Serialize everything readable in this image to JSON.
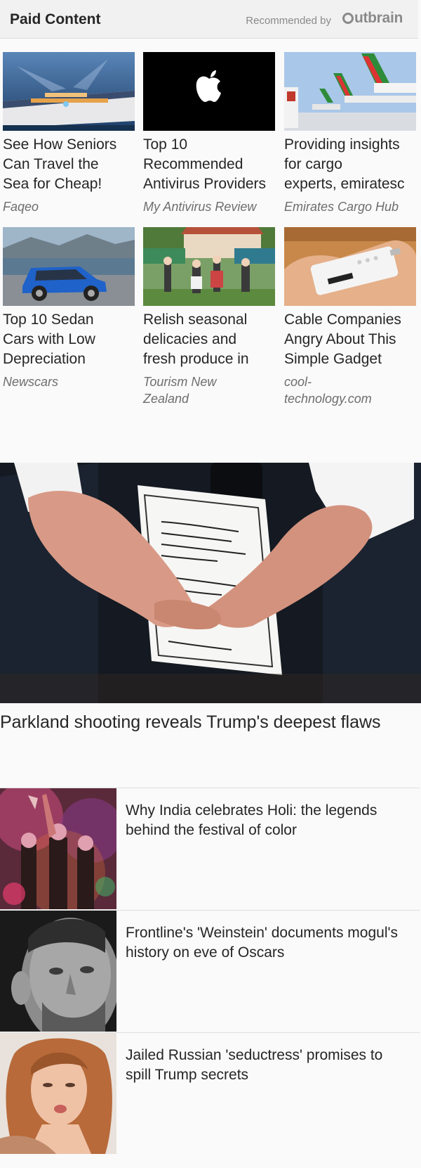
{
  "paid_content": {
    "title": "Paid Content",
    "recommended_by": "Recommended by",
    "logo_text": "utbrain",
    "cards": [
      {
        "headline": [
          "See How Seniors",
          "Can Travel the",
          "Sea for Cheap!"
        ],
        "source": "Faqeo"
      },
      {
        "headline": [
          "Top 10",
          "Recommended",
          "Antivirus Providers"
        ],
        "source": "My Antivirus Review"
      },
      {
        "headline": [
          "Providing insights",
          "for cargo",
          "experts, emiratesc"
        ],
        "source": "Emirates Cargo Hub"
      },
      {
        "headline": [
          "Top 10 Sedan",
          "Cars with Low",
          "Depreciation"
        ],
        "source": "Newscars"
      },
      {
        "headline": [
          "Relish seasonal",
          "delicacies and",
          "fresh produce in"
        ],
        "source": "Tourism New Zealand"
      },
      {
        "headline": [
          "Cable Companies",
          "Angry About This",
          "Simple Gadget"
        ],
        "source": "cool-technology.com"
      }
    ]
  },
  "hero": {
    "image_icon": "hands-holding-note-image",
    "title": "Parkland shooting reveals Trump's deepest flaws"
  },
  "stories": [
    {
      "title": "Why India celebrates Holi: the legends behind the festival of color",
      "image_icon": "holi-festival-image"
    },
    {
      "title": "Frontline's 'Weinstein' documents mogul's history on eve of Oscars",
      "image_icon": "weinstein-portrait-image"
    },
    {
      "title": "Jailed Russian 'seductress' promises to spill Trump secrets",
      "image_icon": "woman-portrait-image"
    }
  ]
}
